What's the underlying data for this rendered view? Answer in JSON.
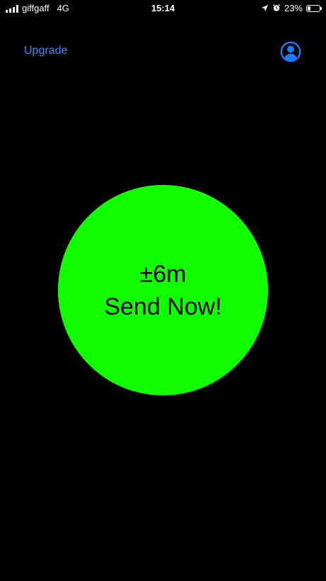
{
  "status_bar": {
    "carrier": "giffgaff",
    "network": "4G",
    "time": "15:14",
    "battery_percent_label": "23%",
    "battery_level": 0.23
  },
  "nav": {
    "upgrade_label": "Upgrade"
  },
  "send_button": {
    "accuracy": "±6m",
    "label": "Send Now!",
    "color": "#12ff00"
  },
  "colors": {
    "background": "#000000",
    "link": "#3a8bff",
    "profile_icon": "#1a7cff"
  },
  "icons": {
    "location": "location-arrow-icon",
    "alarm": "alarm-clock-icon",
    "profile": "user-circle-icon"
  }
}
